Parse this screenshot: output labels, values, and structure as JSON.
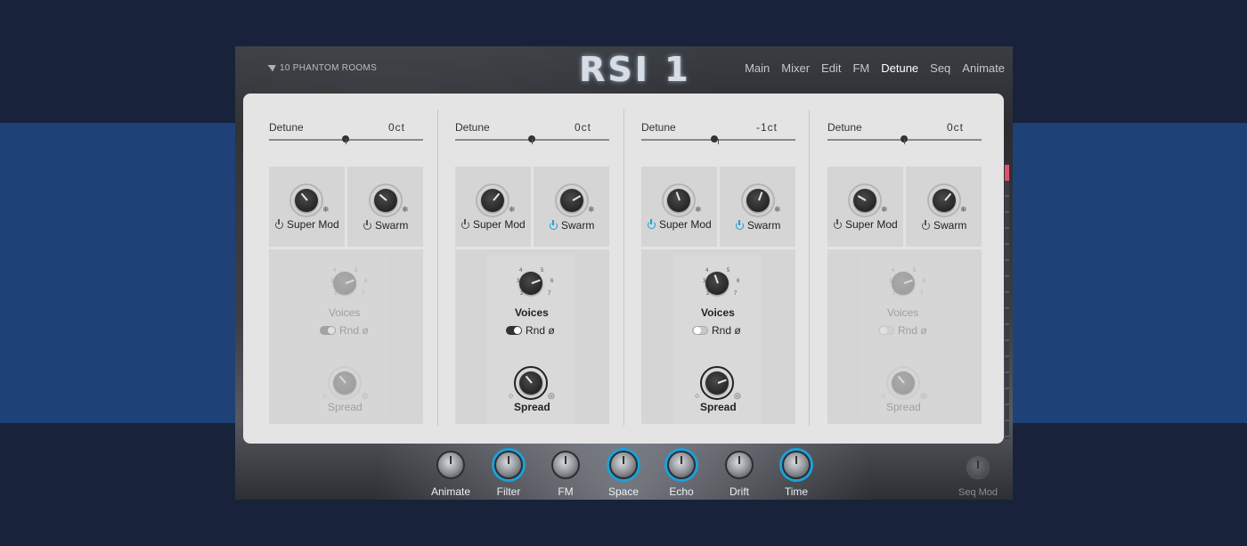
{
  "brand": "10 PHANTOM ROOMS",
  "title": "RSI 1",
  "nav": [
    {
      "label": "Main",
      "active": false
    },
    {
      "label": "Mixer",
      "active": false
    },
    {
      "label": "Edit",
      "active": false
    },
    {
      "label": "FM",
      "active": false
    },
    {
      "label": "Detune",
      "active": true
    },
    {
      "label": "Seq",
      "active": false
    },
    {
      "label": "Animate",
      "active": false
    }
  ],
  "columns": [
    {
      "detune_label": "Detune",
      "detune_value": "0ct",
      "super_mod": "Super Mod",
      "super_mod_on": false,
      "swarm": "Swarm",
      "swarm_on": false,
      "voices": "Voices",
      "rnd": "Rnd ø",
      "rnd_on": true,
      "spread": "Spread",
      "enabled": false
    },
    {
      "detune_label": "Detune",
      "detune_value": "0ct",
      "super_mod": "Super Mod",
      "super_mod_on": false,
      "swarm": "Swarm",
      "swarm_on": true,
      "voices": "Voices",
      "rnd": "Rnd ø",
      "rnd_on": true,
      "spread": "Spread",
      "enabled": true
    },
    {
      "detune_label": "Detune",
      "detune_value": "-1ct",
      "super_mod": "Super Mod",
      "super_mod_on": true,
      "swarm": "Swarm",
      "swarm_on": true,
      "voices": "Voices",
      "rnd": "Rnd ø",
      "rnd_on": false,
      "spread": "Spread",
      "enabled": true
    },
    {
      "detune_label": "Detune",
      "detune_value": "0ct",
      "super_mod": "Super Mod",
      "super_mod_on": false,
      "swarm": "Swarm",
      "swarm_on": false,
      "voices": "Voices",
      "rnd": "Rnd ø",
      "rnd_on": false,
      "spread": "Spread",
      "enabled": false
    }
  ],
  "voice_ticks": [
    "2",
    "3",
    "4",
    "5",
    "6",
    "7"
  ],
  "macros": [
    {
      "label": "Animate",
      "active": false
    },
    {
      "label": "Filter",
      "active": true
    },
    {
      "label": "FM",
      "active": false
    },
    {
      "label": "Space",
      "active": true
    },
    {
      "label": "Echo",
      "active": true
    },
    {
      "label": "Drift",
      "active": false
    },
    {
      "label": "Time",
      "active": true
    }
  ],
  "seq_mod": "Seq Mod",
  "colors": {
    "accent": "#1aa1dc",
    "panel": "#e4e4e4",
    "background": "#18223a",
    "band": "#1e4277"
  }
}
